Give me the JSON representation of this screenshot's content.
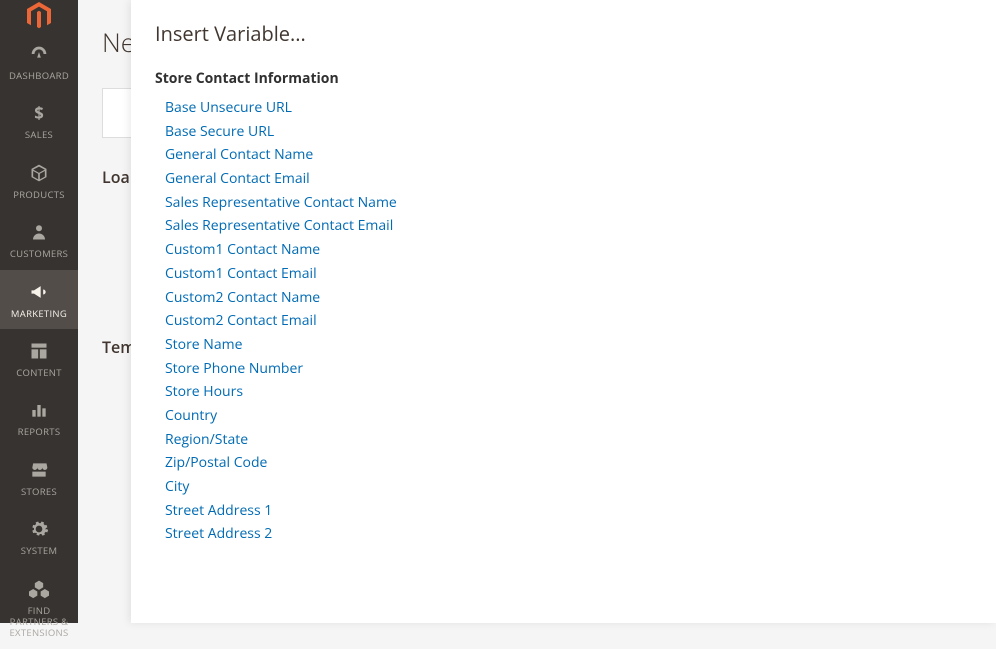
{
  "sidebar": {
    "items": [
      {
        "label": "DASHBOARD",
        "icon": "dashboard"
      },
      {
        "label": "SALES",
        "icon": "dollar"
      },
      {
        "label": "PRODUCTS",
        "icon": "cube"
      },
      {
        "label": "CUSTOMERS",
        "icon": "person"
      },
      {
        "label": "MARKETING",
        "icon": "megaphone",
        "active": true
      },
      {
        "label": "CONTENT",
        "icon": "layout"
      },
      {
        "label": "REPORTS",
        "icon": "bar-chart"
      },
      {
        "label": "STORES",
        "icon": "storefront"
      },
      {
        "label": "SYSTEM",
        "icon": "gear"
      },
      {
        "label": "FIND PARTNERS & EXTENSIONS",
        "icon": "boxes"
      }
    ]
  },
  "page": {
    "title_partial": "Ne",
    "section1": "Loa",
    "section2": "Tem"
  },
  "modal": {
    "title": "Insert Variable...",
    "group_title": "Store Contact Information",
    "variables": [
      "Base Unsecure URL",
      "Base Secure URL",
      "General Contact Name",
      "General Contact Email",
      "Sales Representative Contact Name",
      "Sales Representative Contact Email",
      "Custom1 Contact Name",
      "Custom1 Contact Email",
      "Custom2 Contact Name",
      "Custom2 Contact Email",
      "Store Name",
      "Store Phone Number",
      "Store Hours",
      "Country",
      "Region/State",
      "Zip/Postal Code",
      "City",
      "Street Address 1",
      "Street Address 2"
    ]
  }
}
